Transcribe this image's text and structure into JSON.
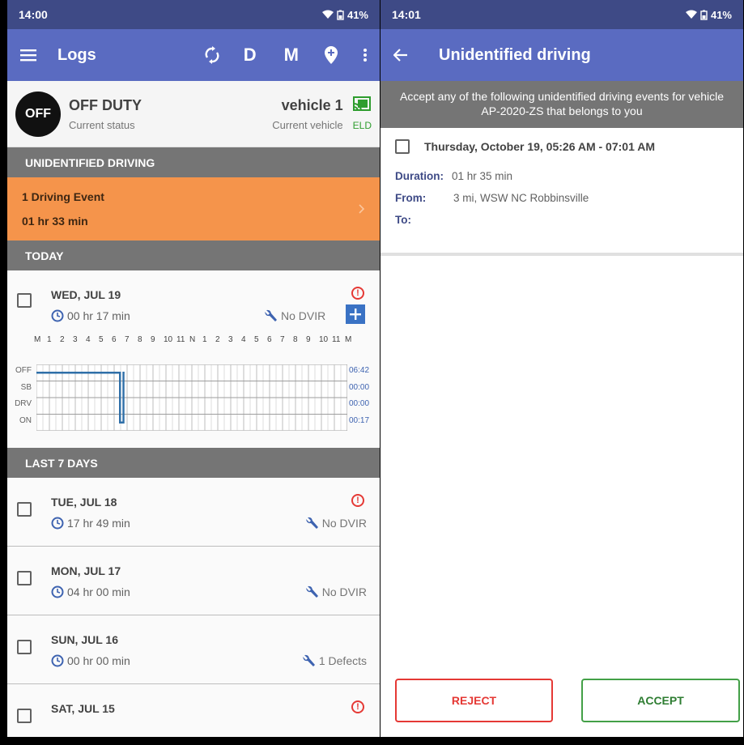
{
  "left": {
    "status_bar": {
      "time": "14:00",
      "battery": "41%"
    },
    "app_bar": {
      "title": "Logs",
      "d_label": "D",
      "m_label": "M"
    },
    "current": {
      "badge": "OFF",
      "status": "OFF DUTY",
      "status_caption": "Current status",
      "vehicle": "vehicle 1",
      "vehicle_caption": "Current vehicle",
      "eld_label": "ELD"
    },
    "unidentified_header": "UNIDENTIFIED DRIVING",
    "driving_event": {
      "title": "1 Driving Event",
      "duration": "01 hr 33 min"
    },
    "today_header": "TODAY",
    "today": {
      "day": "WED, JUL 19",
      "duration": "00 hr 17 min",
      "dvir": "No DVIR",
      "graph": {
        "hour_labels": [
          "M",
          "1",
          "2",
          "3",
          "4",
          "5",
          "6",
          "7",
          "8",
          "9",
          "10",
          "11",
          "N",
          "1",
          "2",
          "3",
          "4",
          "5",
          "6",
          "7",
          "8",
          "9",
          "10",
          "11",
          "M"
        ],
        "rows": [
          "OFF",
          "SB",
          "DRV",
          "ON"
        ],
        "totals": [
          "06:42",
          "00:00",
          "00:00",
          "00:17"
        ]
      }
    },
    "last7_header": "LAST 7 DAYS",
    "days": [
      {
        "day": "TUE, JUL 18",
        "duration": "17 hr 49 min",
        "dvir": "No DVIR",
        "alert": true
      },
      {
        "day": "MON, JUL 17",
        "duration": "04 hr 00 min",
        "dvir": "No DVIR",
        "alert": false
      },
      {
        "day": "SUN, JUL 16",
        "duration": "00 hr 00 min",
        "dvir": "1 Defects",
        "alert": false
      },
      {
        "day": "SAT, JUL 15",
        "duration": "",
        "dvir": "",
        "alert": true
      }
    ]
  },
  "right": {
    "status_bar": {
      "time": "14:01",
      "battery": "41%"
    },
    "app_bar": {
      "title": "Unidentified driving"
    },
    "banner": "Accept any of the following unidentified driving events for vehicle AP-2020-ZS that belongs to you",
    "event": {
      "date_range": "Thursday, October 19, 05:26 AM - 07:01 AM",
      "duration_key": "Duration:",
      "duration_val": "01 hr 35 min",
      "from_key": "From:",
      "from_val": "3 mi, WSW NC Robbinsville",
      "to_key": "To:",
      "to_val": ""
    },
    "reject_label": "REJECT",
    "accept_label": "ACCEPT"
  },
  "colors": {
    "primary": "#5a6bc1",
    "status_bar": "#3e4a86",
    "driving_event": "#f5944b",
    "section": "#757575",
    "alert": "#e53935",
    "accept": "#43a047",
    "eld": "#2e9d2e",
    "graph_line": "#2f6fa8"
  },
  "icons": [
    "menu-icon",
    "sync-icon",
    "location-icon",
    "more-vert-icon",
    "back-arrow-icon",
    "wifi-icon",
    "battery-icon",
    "cast-icon",
    "clock-icon",
    "wrench-icon",
    "alert-icon",
    "add-icon",
    "chevron-right-icon"
  ]
}
